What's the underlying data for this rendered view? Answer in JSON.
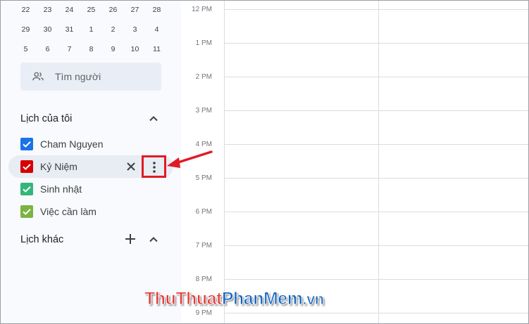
{
  "mini_calendar": {
    "rows": [
      [
        "22",
        "23",
        "24",
        "25",
        "26",
        "27",
        "28"
      ],
      [
        "29",
        "30",
        "31",
        "1",
        "2",
        "3",
        "4"
      ],
      [
        "5",
        "6",
        "7",
        "8",
        "9",
        "10",
        "11"
      ]
    ]
  },
  "search": {
    "label": "Tìm người",
    "icon": "people-icon"
  },
  "my_calendars": {
    "title": "Lịch của tôi",
    "items": [
      {
        "label": "Cham Nguyen",
        "color": "#1a73e8",
        "checked": true
      },
      {
        "label": "Kỷ Niệm",
        "color": "#d50000",
        "checked": true
      },
      {
        "label": "Sinh nhật",
        "color": "#33b679",
        "checked": true
      },
      {
        "label": "Việc cần làm",
        "color": "#7cb342",
        "checked": true
      }
    ]
  },
  "other_calendars": {
    "title": "Lịch khác"
  },
  "timeline": {
    "hours": [
      "12 PM",
      "1 PM",
      "2 PM",
      "3 PM",
      "4 PM",
      "5 PM",
      "6 PM",
      "7 PM",
      "8 PM",
      "9 PM"
    ]
  },
  "watermark": {
    "part1": "ThuThuat",
    "part2": "PhanMem",
    "part3": ".vn"
  },
  "colors": {
    "highlight": "#e01b24",
    "sidebar_bg": "#f8fafd",
    "search_bg": "#e9eef6",
    "grid_line": "#dadce0"
  }
}
